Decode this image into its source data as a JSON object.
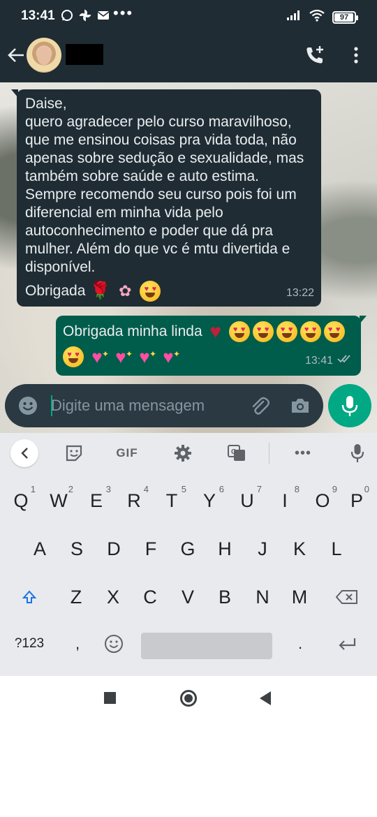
{
  "status_bar": {
    "time": "13:41",
    "notification_icons": [
      "whatsapp-icon",
      "pinwheel-icon",
      "mail-icon"
    ],
    "overflow": "•••",
    "battery_level": "97"
  },
  "header": {
    "contact_name_redacted": true
  },
  "messages": [
    {
      "direction": "incoming",
      "text": "Daise,\nquero agradecer pelo curso maravilhoso, que me ensinou coisas pra vida toda, não apenas sobre sedução e sexualidade, mas também sobre saúde e auto estima.\nSempre recomendo seu curso pois foi um diferencial em minha vida pelo autoconhecimento e poder que dá pra mulher. Além do que vc é mtu divertida e disponível.",
      "sign_off": "Obrigada",
      "sign_emojis": [
        "rose",
        "bouquet",
        "smiling-face-with-hearts"
      ],
      "time": "13:22"
    },
    {
      "direction": "outgoing",
      "text": "Obrigada minha linda",
      "emojis_line1": [
        "red-heart",
        "heart-eyes",
        "heart-eyes",
        "heart-eyes",
        "heart-eyes",
        "heart-eyes"
      ],
      "emojis_line2": [
        "heart-eyes",
        "sparkling-heart",
        "sparkling-heart",
        "sparkling-heart",
        "sparkling-heart"
      ],
      "time": "13:41",
      "status": "read"
    }
  ],
  "composer": {
    "placeholder": "Digite uma mensagem"
  },
  "keyboard": {
    "toolbar": {
      "gif_label": "GIF",
      "more": "•••"
    },
    "row1": [
      {
        "key": "Q",
        "hint": "1"
      },
      {
        "key": "W",
        "hint": "2"
      },
      {
        "key": "E",
        "hint": "3"
      },
      {
        "key": "R",
        "hint": "4"
      },
      {
        "key": "T",
        "hint": "5"
      },
      {
        "key": "Y",
        "hint": "6"
      },
      {
        "key": "U",
        "hint": "7"
      },
      {
        "key": "I",
        "hint": "8"
      },
      {
        "key": "O",
        "hint": "9"
      },
      {
        "key": "P",
        "hint": "0"
      }
    ],
    "row2": [
      "A",
      "S",
      "D",
      "F",
      "G",
      "H",
      "J",
      "K",
      "L"
    ],
    "row3": [
      "Z",
      "X",
      "C",
      "V",
      "B",
      "N",
      "M"
    ],
    "row4": {
      "symbols": "?123",
      "comma": ",",
      "period": "."
    }
  },
  "colors": {
    "header_bg": "#1f2c34",
    "incoming_bubble": "#1f2c34",
    "outgoing_bubble": "#005c4b",
    "accent": "#00a884",
    "keyboard_bg": "#e8eaed"
  }
}
